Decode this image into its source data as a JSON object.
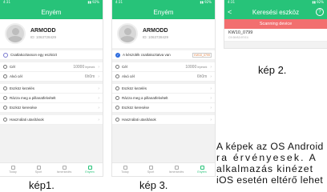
{
  "status_bar": {
    "left": "4:31",
    "right": "▮▮ 92%"
  },
  "screen1": {
    "header": "Enyém",
    "profile": {
      "name": "ARMODD",
      "id": "ID: 1063728429"
    },
    "toggle_label": "Csatlakoztasson egy eszközt",
    "goal_label": "Cél",
    "goal_value": "10000",
    "goal_unit": "lépések",
    "sleep_label": "Alvó cél",
    "sleep_value": "6h0m",
    "menu": [
      "Eszköz kezelés",
      "Rázza meg a pillanatfelvételt",
      "Eszköz keresése",
      "Használati utasítások"
    ],
    "tabs": [
      "Today",
      "Sport",
      "Ismerkedés",
      "Enyém"
    ],
    "caption": "kép1."
  },
  "screen2": {
    "header": "Keresési eszköz",
    "back": "<",
    "help": "?",
    "scan_text": "Scanning device",
    "device_name": "KW10_0799",
    "device_mac": "C9:39:B3:97:E4",
    "caption": "kép 2."
  },
  "screen3": {
    "header": "Enyém",
    "profile": {
      "name": "ARMODD",
      "id": "ID: 1063728429"
    },
    "toggle_label": "A készülék csatlakoztatva van",
    "device_tag": "KW10_0799",
    "goal_label": "Cél",
    "goal_value": "10000",
    "goal_unit": "lépések",
    "sleep_label": "Alvó cél",
    "sleep_value": "6h0m",
    "menu": [
      "Eszköz kezelés",
      "Rázza meg a pillanatfelvételt",
      "Eszköz keresése",
      "Használati utasítások"
    ],
    "tabs": [
      "Today",
      "Sport",
      "Ismerkedés",
      "Enyém"
    ],
    "caption": "kép 3."
  },
  "note": {
    "line1": "A képek az OS Android",
    "line2": "ra érvényesek. A",
    "line3": "alkalmazás kinézet",
    "line4": "iOS esetén eltérő lehet"
  },
  "colors": {
    "green": "#27c379",
    "red_bar": "#f26f6f",
    "blue_check": "#2d6cdf"
  }
}
